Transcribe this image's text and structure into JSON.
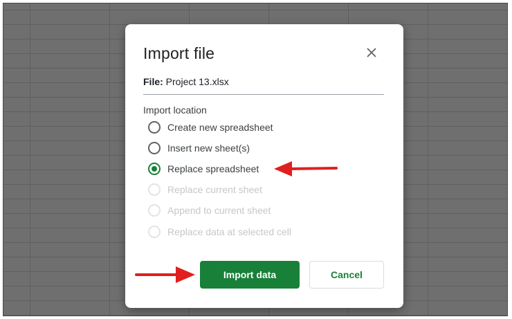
{
  "dialog": {
    "title": "Import file",
    "file_label": "File:",
    "file_name": "Project 13.xlsx",
    "section_label": "Import location",
    "options": [
      {
        "label": "Create new spreadsheet",
        "checked": false,
        "disabled": false
      },
      {
        "label": "Insert new sheet(s)",
        "checked": false,
        "disabled": false
      },
      {
        "label": "Replace spreadsheet",
        "checked": true,
        "disabled": false
      },
      {
        "label": "Replace current sheet",
        "checked": false,
        "disabled": true
      },
      {
        "label": "Append to current sheet",
        "checked": false,
        "disabled": true
      },
      {
        "label": "Replace data at selected cell",
        "checked": false,
        "disabled": true
      }
    ],
    "import_button": "Import data",
    "cancel_button": "Cancel"
  },
  "colors": {
    "accent_green": "#188038",
    "annotation_red": "#e0201e",
    "disabled_text": "#c7c7c7",
    "background_overlay": "#6f6f6f"
  },
  "icons": {
    "close": "close-icon",
    "arrow_annotation": "red-arrow-icon"
  }
}
